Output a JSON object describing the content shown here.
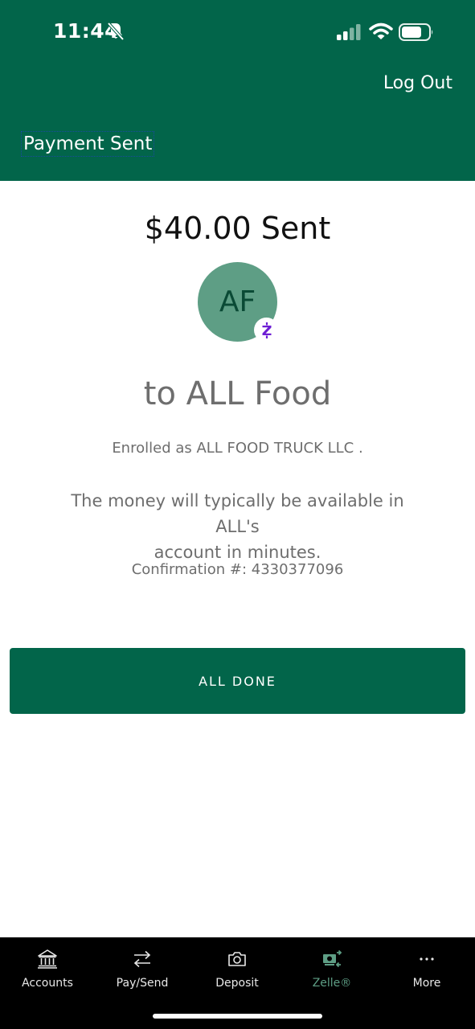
{
  "status_bar": {
    "time": "11:44"
  },
  "header": {
    "logout_label": "Log Out",
    "title": "Payment Sent"
  },
  "payment": {
    "amount_sent": "$40.00 Sent",
    "avatar_initials": "AF",
    "recipient": "to ALL Food",
    "enrolled_as": "Enrolled as ALL FOOD TRUCK LLC .",
    "availability_line1": "The money will typically be available in ALL's",
    "availability_line2": "account in minutes.",
    "confirmation": "Confirmation #: 4330377096",
    "done_label": "ALL DONE"
  },
  "nav": {
    "items": [
      {
        "label": "Accounts",
        "icon": "bank-icon"
      },
      {
        "label": "Pay/Send",
        "icon": "transfer-arrows-icon"
      },
      {
        "label": "Deposit",
        "icon": "camera-icon"
      },
      {
        "label": "Zelle®",
        "icon": "zelle-money-icon",
        "active": true
      },
      {
        "label": "More",
        "icon": "more-dots-icon"
      }
    ]
  },
  "colors": {
    "brand_green": "#02654a",
    "avatar_green": "#5e9e85",
    "zelle_purple": "#6d1ed4"
  }
}
